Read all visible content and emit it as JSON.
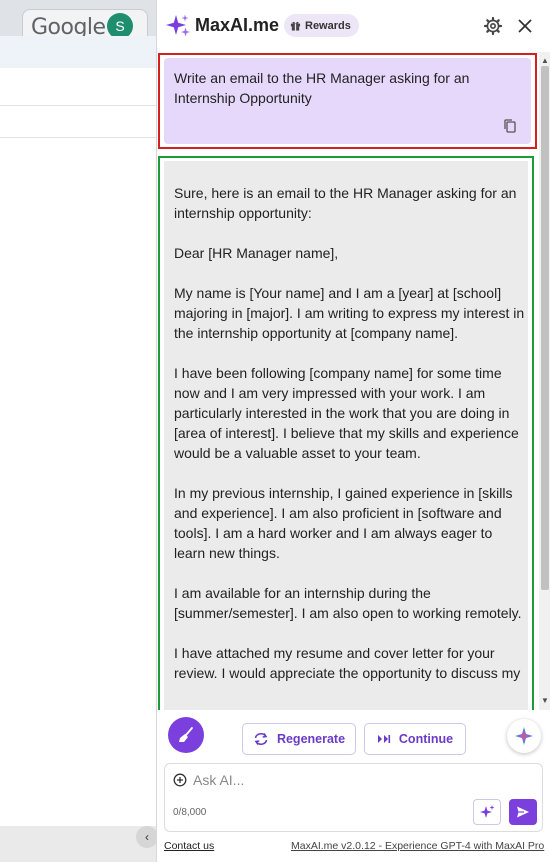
{
  "background_page": {
    "google_logo_text": "Google",
    "avatar_letter": "S",
    "back_chevron": "‹"
  },
  "panel": {
    "app_title": "MaxAI.me",
    "rewards_label": "Rewards",
    "icons": {
      "logo": "sparkle-logo-icon",
      "rewards": "gift-icon",
      "settings": "gear-icon",
      "close": "close-icon",
      "copy": "copy-icon",
      "clear": "broom-icon",
      "regenerate": "refresh-icon",
      "continue": "double-chevron-icon",
      "assistant": "sparkle-icon",
      "attach": "plus-circle-icon",
      "prompt": "sparkle-prompt-icon",
      "send": "send-icon"
    },
    "colors": {
      "accent": "#7a3fdd",
      "user_bubble": "#e6d8fb",
      "ai_bubble": "#ebebeb",
      "highlight_red": "#d42020",
      "highlight_green": "#1f9a3a"
    }
  },
  "chat": {
    "user_message": "Write an email to the HR Manager asking for an Internship Opportunity",
    "ai_paragraphs": [
      "Sure, here is an email to the HR Manager asking for an internship opportunity:",
      "Dear [HR Manager name],",
      "My name is [Your name] and I am a [year] at [school] majoring in [major]. I am writing to express my interest in the internship opportunity at [company name].",
      "I have been following [company name] for some time now and I am very impressed with your work. I am particularly interested in the work that you are doing in [area of interest]. I believe that my skills and experience would be a valuable asset to your team.",
      "In my previous internship, I gained experience in [skills and experience]. I am also proficient in [software and tools]. I am a hard worker and I am always eager to learn new things.",
      "I am available for an internship during the [summer/semester]. I am also open to working remotely.",
      "I have attached my resume and cover letter for your review. I would appreciate the opportunity to discuss my"
    ]
  },
  "actions": {
    "regenerate_label": "Regenerate",
    "continue_label": "Continue"
  },
  "input": {
    "placeholder": "Ask AI...",
    "char_count": "0/8,000"
  },
  "footer": {
    "contact_label": "Contact us",
    "version_label": "MaxAI.me v2.0.12 - Experience GPT-4 with MaxAI Pro"
  }
}
